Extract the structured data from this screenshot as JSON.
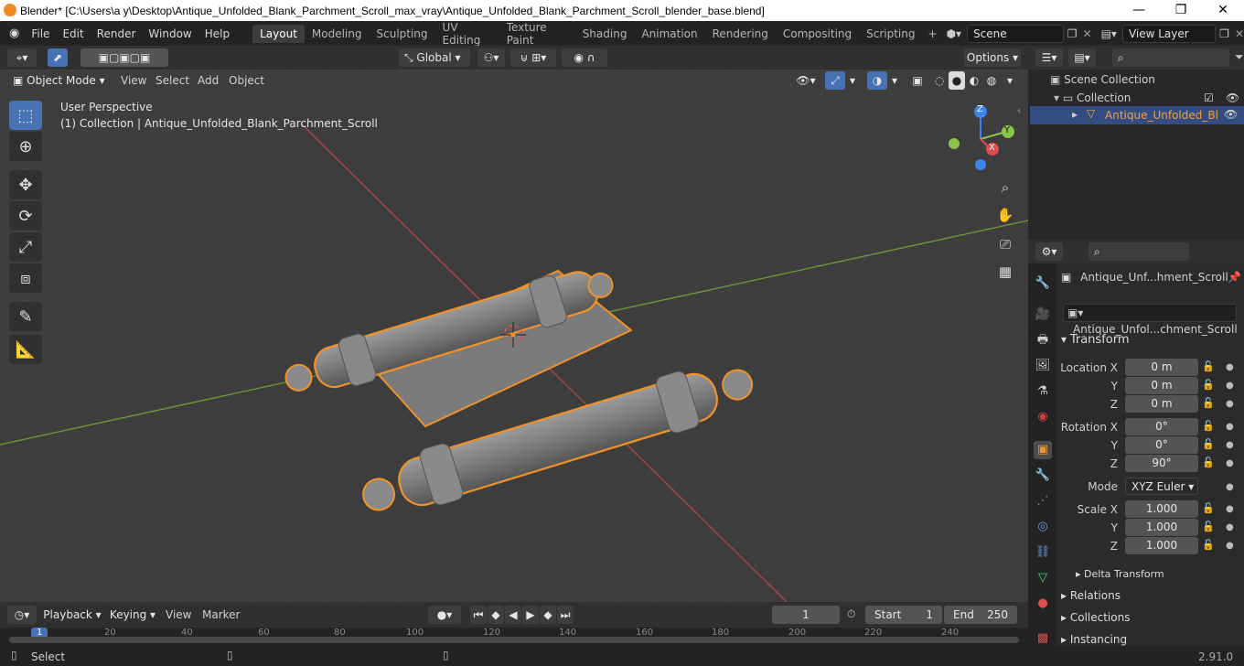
{
  "titlebar": {
    "title": "Blender* [C:\\Users\\a y\\Desktop\\Antique_Unfolded_Blank_Parchment_Scroll_max_vray\\Antique_Unfolded_Blank_Parchment_Scroll_blender_base.blend]",
    "minimize": "—",
    "maximize": "❐",
    "close": "✕"
  },
  "menu": [
    "File",
    "Edit",
    "Render",
    "Window",
    "Help"
  ],
  "workspaces": [
    "Layout",
    "Modeling",
    "Sculpting",
    "UV Editing",
    "Texture Paint",
    "Shading",
    "Animation",
    "Rendering",
    "Compositing",
    "Scripting"
  ],
  "scene": {
    "label": "Scene",
    "viewlayer": "View Layer"
  },
  "viewport_header": {
    "transform_orientation": "Global",
    "options": "Options",
    "mode": "Object Mode",
    "menus": [
      "View",
      "Select",
      "Add",
      "Object"
    ]
  },
  "viewport": {
    "perspective": "User Perspective",
    "collection_info": "(1) Collection | Antique_Unfolded_Blank_Parchment_Scroll",
    "gizmo": {
      "z": "Z",
      "y": "Y",
      "x": "X"
    }
  },
  "outliner": {
    "scene_collection": "Scene Collection",
    "collection": "Collection",
    "object": "Antique_Unfolded_Bl"
  },
  "properties": {
    "object_name": "Antique_Unf...hment_Scroll",
    "data_name": "Antique_Unfol...chment_Scroll",
    "transform_header": "Transform",
    "location": {
      "label": "Location X",
      "x": "0 m",
      "y": "0 m",
      "z": "0 m"
    },
    "rotation": {
      "label": "Rotation X",
      "x": "0°",
      "y": "0°",
      "z": "90°"
    },
    "mode": {
      "label": "Mode",
      "value": "XYZ Euler"
    },
    "scale": {
      "label": "Scale X",
      "x": "1.000",
      "y": "1.000",
      "z": "1.000"
    },
    "axis_y": "Y",
    "axis_z": "Z",
    "delta": "Delta Transform",
    "relations": "Relations",
    "collections": "Collections",
    "instancing": "Instancing"
  },
  "timeline": {
    "menus": [
      "Playback",
      "Keying",
      "View",
      "Marker"
    ],
    "current_frame": "1",
    "start_label": "Start",
    "start": "1",
    "end_label": "End",
    "end": "250",
    "ticks": [
      "1",
      "20",
      "40",
      "60",
      "80",
      "100",
      "120",
      "140",
      "160",
      "180",
      "200",
      "220",
      "240"
    ]
  },
  "status": {
    "left": "Select",
    "version": "2.91.0"
  },
  "colors": {
    "selection": "#4772b3",
    "outline": "#f0922c",
    "x_axis": "#e04b4b",
    "y_axis": "#8bc34a",
    "z_axis": "#3b84f0"
  }
}
